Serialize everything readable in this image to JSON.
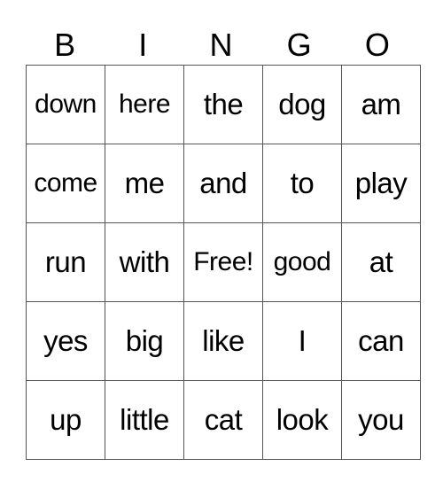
{
  "header": [
    "B",
    "I",
    "N",
    "G",
    "O"
  ],
  "rows": [
    [
      "down",
      "here",
      "the",
      "dog",
      "am"
    ],
    [
      "come",
      "me",
      "and",
      "to",
      "play"
    ],
    [
      "run",
      "with",
      "Free!",
      "good",
      "at"
    ],
    [
      "yes",
      "big",
      "like",
      "I",
      "can"
    ],
    [
      "up",
      "little",
      "cat",
      "look",
      "you"
    ]
  ]
}
